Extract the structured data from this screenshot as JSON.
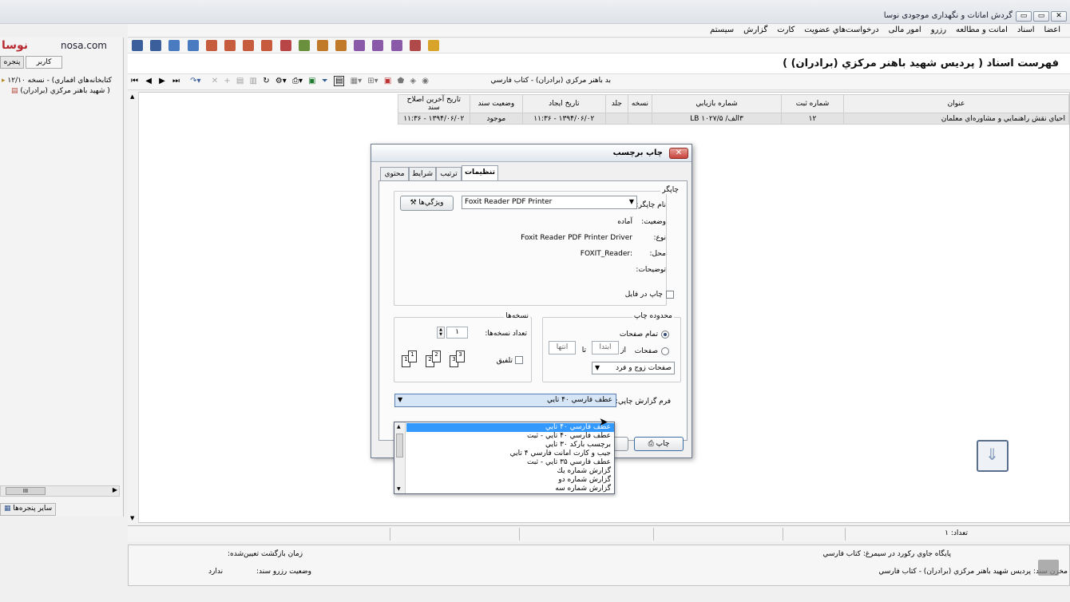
{
  "window": {
    "title": "گردش امانات و نگهداری موجودی نوسا",
    "controls": [
      "▭",
      "▭",
      "✕"
    ]
  },
  "menu": [
    "اعضا",
    "اسناد",
    "امانت و مطالعه",
    "رزرو",
    "امور مالی",
    "درخواست‌هاي عضويت",
    "كارت",
    "گزارش",
    "سيستم"
  ],
  "left": {
    "brand": "نوسا",
    "site": "nosa.com",
    "tabs": [
      "كاربر",
      "پنجره"
    ],
    "tree": [
      "كتابخانه‌هاي افماري) - نسخه ۱۲/۱۰",
      "شهيد باهنر مركزي (برادران) )"
    ],
    "scroll_thumb": "III",
    "other_windows": "ساير پنجره‌ها"
  },
  "header": {
    "title": "فهرست اسناد ( پرديس شهيد باهنر مركزي (برادران) )"
  },
  "filter": {
    "text": "بد باهنر مركزي (برادران) - كتاب فارسي"
  },
  "grid": {
    "columns": [
      "عنوان",
      "شماره ثبت",
      "شماره بازيابي",
      "نسخه",
      "جلد",
      "تاريخ ايجاد",
      "وضعيت سند",
      "تاريخ آخرين اصلاح سند"
    ],
    "rows": [
      [
        "احياي نقش راهنمايي و مشاوره‌اي معلمان",
        "۱۲",
        "۳الف/ LB ۱۰۲۷/۵",
        "",
        "",
        "۱۳۹۴/۰۶/۰۲ - ۱۱:۳۶",
        "موجود",
        "۱۳۹۴/۰۶/۰۲ - ۱۱:۳۶"
      ]
    ]
  },
  "status": {
    "count_label": "تعداد: ۱"
  },
  "info": {
    "left1_label": "زمان بازگشت تعيين‌شده:",
    "left2_label": "وضعيت رزرو سند:",
    "left2_value": "ندارد",
    "right1": "پايگاه جاوي ركورد در سيمرغ: كتاب فارسي",
    "right2": "مخزن سند: پرديس شهيد باهنر مركزي (برادران) - كتاب فارسي"
  },
  "dialog": {
    "title": "چاپ برچسب",
    "tabs": [
      "تنظيمات",
      "ترتيب",
      "شرايط",
      "محتوي"
    ],
    "printer_group": "چاپگر",
    "printer_name_label": "نام چاپگر:",
    "printer_name_value": "Foxit Reader PDF Printer",
    "properties_button": "ويژگي‌ها",
    "status_label": "وضعيت:",
    "status_value": "آماده",
    "type_label": "نوع:",
    "type_value": "Foxit Reader PDF Printer Driver",
    "location_label": "محل:",
    "location_value": "FOXIT_Reader:",
    "comment_label": "توضيحات:",
    "print_to_file": "چاپ در فايل",
    "range_group": "محدوده چاپ",
    "all_pages": "تمام صفحات",
    "pages": "صفحات",
    "from_label": "از",
    "from_placeholder": "ابتدا",
    "to_label": "تا",
    "to_placeholder": "انتها",
    "odd_even": "صفحات زوج و فرد",
    "copies_group": "نسخه‌ها",
    "copies_label": "تعداد نسخه‌ها:",
    "copies_value": "۱",
    "collate": "تلفيق",
    "report_form_label": "فرم گزارش چاپي:",
    "report_form_value": "عطف فارسي ۴۰ تايي",
    "print_button": "چاپ"
  },
  "dropdown_options": [
    "عطف فارسي ۴۰ تايي",
    "عطف فارسي ۴۰ تايي - ثبت",
    "برچسب باركد ۳۰ تايي",
    "جيب و كارت امانت فارسي ۴ تايي",
    "عطف فارسي ۳۵ تايي - ثبت",
    "گزارش شماره يك",
    "گزارش شماره دو",
    "گزارش شماره سه"
  ],
  "colors": {
    "selection": "#3399ff",
    "close": "#c7433a",
    "brand": "#b8292f"
  }
}
